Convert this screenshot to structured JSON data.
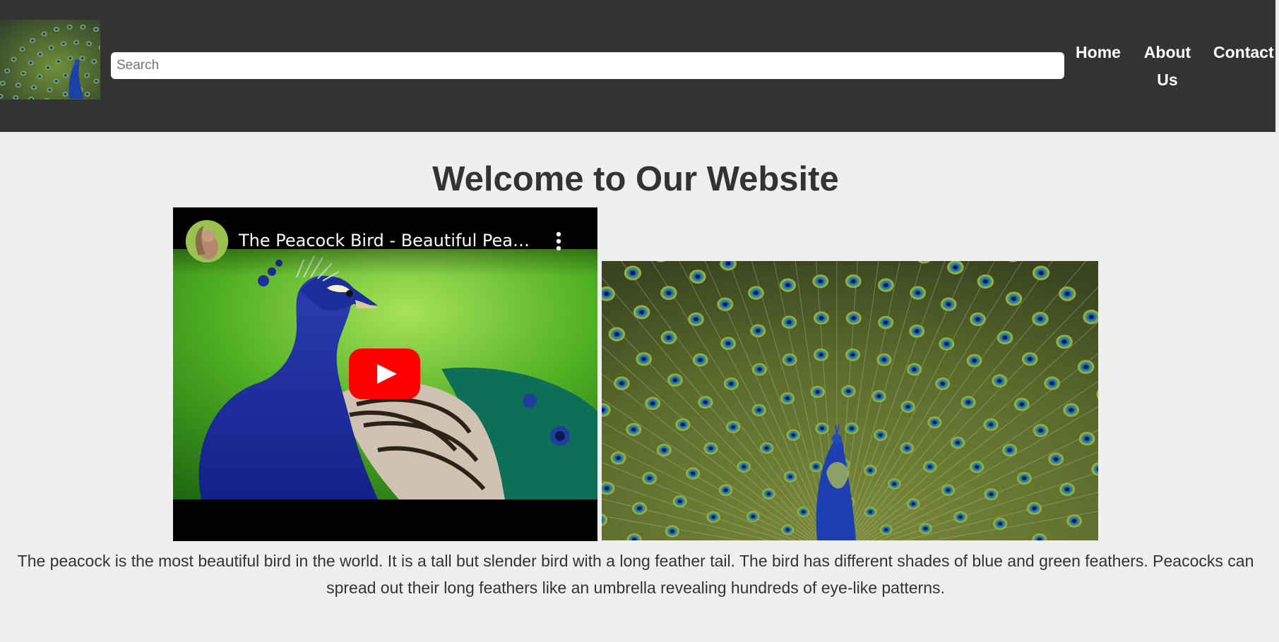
{
  "header": {
    "logo": {
      "icon": "peacock-logo-image"
    },
    "search": {
      "placeholder": "Search",
      "value": ""
    },
    "nav": [
      {
        "label": "Home"
      },
      {
        "label": "About Us"
      },
      {
        "label": "Contact"
      }
    ]
  },
  "main": {
    "title": "Welcome to Our Website",
    "video": {
      "title": "The Peacock Bird - Beautiful Peacock Bird",
      "icons": [
        "channel-avatar",
        "more-vert-icon",
        "youtube-play-icon"
      ],
      "play_color": "#ff0000"
    },
    "photo": {
      "icon": "peacock-feathers-image"
    },
    "description": "The peacock is the most beautiful bird in the world. It is a tall but slender bird with a long feather tail. The bird has different shades of blue and green feathers. Peacocks can spread out their long feathers like an umbrella revealing hundreds of eye-like patterns."
  },
  "colors": {
    "header_bg": "#333333",
    "page_bg": "#efefef",
    "text": "#333333"
  }
}
